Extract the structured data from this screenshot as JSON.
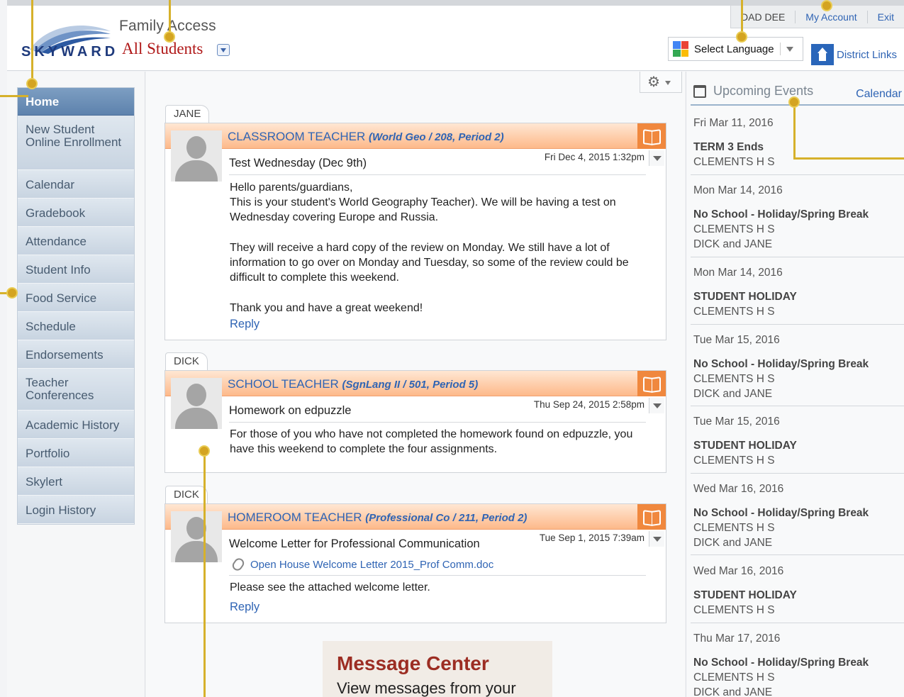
{
  "header": {
    "logo_text": "SKYWARD",
    "product_title": "Family Access",
    "student_selector": "All Students",
    "user_name": "DAD DEE",
    "my_account": "My Account",
    "exit": "Exit",
    "select_language": "Select Language",
    "district_links": "District Links"
  },
  "sidebar": {
    "items": [
      {
        "label": "Home",
        "active": true
      },
      {
        "label": "New Student Online Enrollment"
      },
      {
        "label": "Calendar"
      },
      {
        "label": "Gradebook"
      },
      {
        "label": "Attendance"
      },
      {
        "label": "Student Info"
      },
      {
        "label": "Food Service"
      },
      {
        "label": "Schedule"
      },
      {
        "label": "Endorsements"
      },
      {
        "label": "Teacher Conferences"
      },
      {
        "label": "Academic History"
      },
      {
        "label": "Portfolio"
      },
      {
        "label": "Skylert"
      },
      {
        "label": "Login History"
      }
    ]
  },
  "messages": [
    {
      "student": "JANE",
      "sender": "CLASSROOM TEACHER",
      "course": "(World Geo / 208, Period 2)",
      "date": "Fri Dec 4, 2015 1:32pm",
      "subject": "Test Wednesday (Dec 9th)",
      "body": [
        "Hello parents/guardians,",
        "This is your student's World Geography Teacher). We will be having a test on Wednesday covering Europe and Russia.",
        "They will receive a hard copy of the review on Monday. We still have a lot of information to go over on Monday and Tuesday, so some of the review could be difficult to complete this weekend.",
        "Thank you and have a great weekend!"
      ],
      "reply": "Reply"
    },
    {
      "student": "DICK",
      "sender": "SCHOOL TEACHER",
      "course": "(SgnLang II / 501, Period 5)",
      "date": "Thu Sep 24, 2015 2:58pm",
      "subject": "Homework on edpuzzle",
      "body": [
        "For those of you who have not completed the homework found on edpuzzle, you have this weekend to complete the four assignments."
      ]
    },
    {
      "student": "DICK",
      "sender": "HOMEROOM TEACHER",
      "course": "(Professional Co / 211, Period 2)",
      "date": "Tue Sep 1, 2015 7:39am",
      "subject": "Welcome Letter for Professional Communication",
      "attachment": "Open House Welcome Letter 2015_Prof Comm.doc",
      "body": [
        "Please see the attached welcome letter."
      ],
      "reply": "Reply"
    }
  ],
  "events": {
    "title": "Upcoming Events",
    "calendar_link": "Calendar",
    "items": [
      {
        "date": "Fri Mar 11, 2016",
        "title": "TERM 3 Ends",
        "lines": [
          "CLEMENTS H S"
        ]
      },
      {
        "date": "Mon Mar 14, 2016",
        "title": "No School - Holiday/Spring Break",
        "lines": [
          "CLEMENTS H S",
          "DICK and JANE"
        ]
      },
      {
        "date": "Mon Mar 14, 2016",
        "title": "STUDENT HOLIDAY",
        "lines": [
          "CLEMENTS H S"
        ]
      },
      {
        "date": "Tue Mar 15, 2016",
        "title": "No School - Holiday/Spring Break",
        "lines": [
          "CLEMENTS H S",
          "DICK and JANE"
        ]
      },
      {
        "date": "Tue Mar 15, 2016",
        "title": "STUDENT HOLIDAY",
        "lines": [
          "CLEMENTS H S"
        ]
      },
      {
        "date": "Wed Mar 16, 2016",
        "title": "No School - Holiday/Spring Break",
        "lines": [
          "CLEMENTS H S",
          "DICK and JANE"
        ]
      },
      {
        "date": "Wed Mar 16, 2016",
        "title": "STUDENT HOLIDAY",
        "lines": [
          "CLEMENTS H S"
        ]
      },
      {
        "date": "Thu Mar 17, 2016",
        "title": "No School - Holiday/Spring Break",
        "lines": [
          "CLEMENTS H S",
          "DICK and JANE"
        ]
      }
    ]
  },
  "callout": {
    "title": "Message Center",
    "text": "View messages from your"
  },
  "colors": {
    "accent_link": "#2f64b4",
    "nav_active": "#5d82ad",
    "message_header": "#fdb98a",
    "callout_title": "#9c2d23",
    "annotation": "#d4a421"
  }
}
